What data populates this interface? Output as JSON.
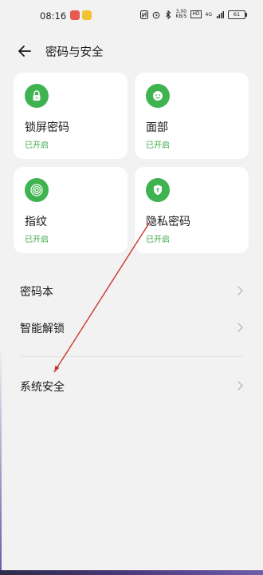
{
  "status_bar": {
    "time": "08:16",
    "net_speed_value": "3.00",
    "net_speed_unit": "KB/S",
    "hd_label": "HD",
    "signal_label": "4G",
    "battery": "61"
  },
  "header": {
    "back_icon": "arrow-left-icon",
    "title": "密码与安全"
  },
  "cards": [
    {
      "title": "锁屏密码",
      "status": "已开启",
      "icon": "lock-icon"
    },
    {
      "title": "面部",
      "status": "已开启",
      "icon": "face-icon"
    },
    {
      "title": "指纹",
      "status": "已开启",
      "icon": "fingerprint-icon"
    },
    {
      "title": "隐私密码",
      "status": "已开启",
      "icon": "shield-icon"
    }
  ],
  "list": [
    {
      "label": "密码本"
    },
    {
      "label": "智能解锁"
    },
    {
      "label": "系统安全"
    }
  ],
  "colors": {
    "accent_green": "#3fb34f",
    "status_green": "#42a84c",
    "background": "#f2f2f2"
  }
}
